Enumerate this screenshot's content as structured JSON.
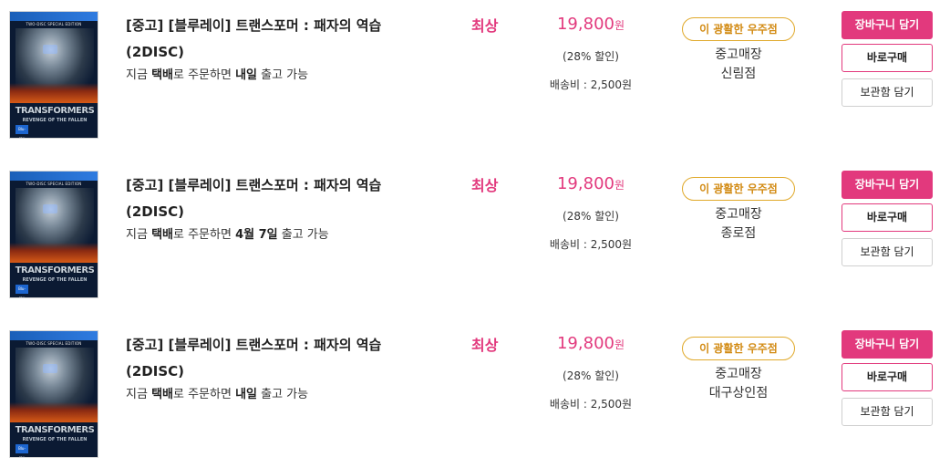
{
  "items": [
    {
      "cover": {
        "edition": "TWO-DISC SPECIAL EDITION",
        "logo": "TRANSFORMERS",
        "subtitle": "REVENGE OF THE FALLEN",
        "badge": "Blu-ray"
      },
      "title": "[중고] [블루레이] 트랜스포머 : 패자의 역습 (2DISC)",
      "shipping": {
        "prefix": "지금 ",
        "method": "택배",
        "middle": "로 주문하면 ",
        "day": "내일",
        "suffix": " 출고 가능"
      },
      "grade": "최상",
      "price": {
        "amount": "19,800",
        "unit": "원"
      },
      "discount": "(28% 할인)",
      "shipping_fee": "배송비 : 2,500원",
      "badge": "이 광활한 우주점",
      "store": {
        "line1": "중고매장",
        "line2": "신림점"
      },
      "buttons": {
        "cart": "장바구니 담기",
        "buy": "바로구매",
        "keep": "보관함 담기"
      }
    },
    {
      "cover": {
        "edition": "TWO-DISC SPECIAL EDITION",
        "logo": "TRANSFORMERS",
        "subtitle": "REVENGE OF THE FALLEN",
        "badge": "Blu-ray"
      },
      "title": "[중고] [블루레이] 트랜스포머 : 패자의 역습 (2DISC)",
      "shipping": {
        "prefix": "지금 ",
        "method": "택배",
        "middle": "로 주문하면 ",
        "day": "4월 7일",
        "suffix": " 출고 가능"
      },
      "grade": "최상",
      "price": {
        "amount": "19,800",
        "unit": "원"
      },
      "discount": "(28% 할인)",
      "shipping_fee": "배송비 : 2,500원",
      "badge": "이 광활한 우주점",
      "store": {
        "line1": "중고매장",
        "line2": "종로점"
      },
      "buttons": {
        "cart": "장바구니 담기",
        "buy": "바로구매",
        "keep": "보관함 담기"
      }
    },
    {
      "cover": {
        "edition": "TWO-DISC SPECIAL EDITION",
        "logo": "TRANSFORMERS",
        "subtitle": "REVENGE OF THE FALLEN",
        "badge": "Blu-ray"
      },
      "title": "[중고] [블루레이] 트랜스포머 : 패자의 역습 (2DISC)",
      "shipping": {
        "prefix": "지금 ",
        "method": "택배",
        "middle": "로 주문하면 ",
        "day": "내일",
        "suffix": " 출고 가능"
      },
      "grade": "최상",
      "price": {
        "amount": "19,800",
        "unit": "원"
      },
      "discount": "(28% 할인)",
      "shipping_fee": "배송비 : 2,500원",
      "badge": "이 광활한 우주점",
      "store": {
        "line1": "중고매장",
        "line2": "대구상인점"
      },
      "buttons": {
        "cart": "장바구니 담기",
        "buy": "바로구매",
        "keep": "보관함 담기"
      }
    }
  ],
  "colors": {
    "accent": "#e2397d",
    "badge": "#d28a12",
    "badge_border": "#e0a92a"
  }
}
